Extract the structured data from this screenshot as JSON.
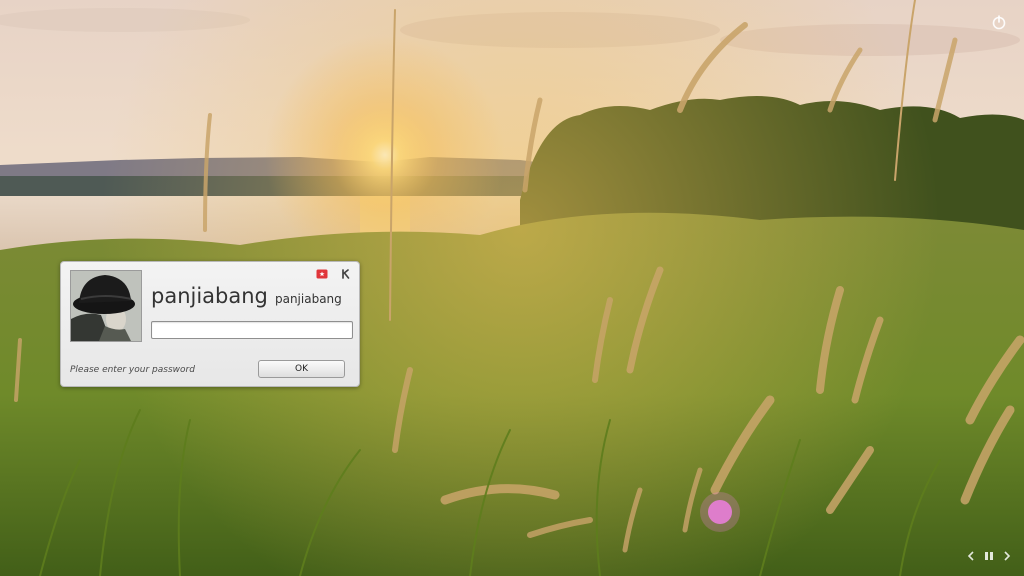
{
  "desktop": {
    "wallpaper": "sunset-grass-field",
    "power_icon": "power-icon",
    "layout_switch_icons": [
      "chevron-left-icon",
      "pause-icon",
      "chevron-right-icon"
    ]
  },
  "login": {
    "user": {
      "display_name": "panjiabang",
      "login_name": "panjiabang"
    },
    "password": {
      "value": "",
      "placeholder": ""
    },
    "prompt": "Please enter your password",
    "ok_label": "OK",
    "controls": [
      "keyboard-layout-icon",
      "session-k-icon"
    ]
  },
  "colors": {
    "accent_red": "#e0353a",
    "dialog_bg": "#eeeeee",
    "text": "#333333"
  }
}
